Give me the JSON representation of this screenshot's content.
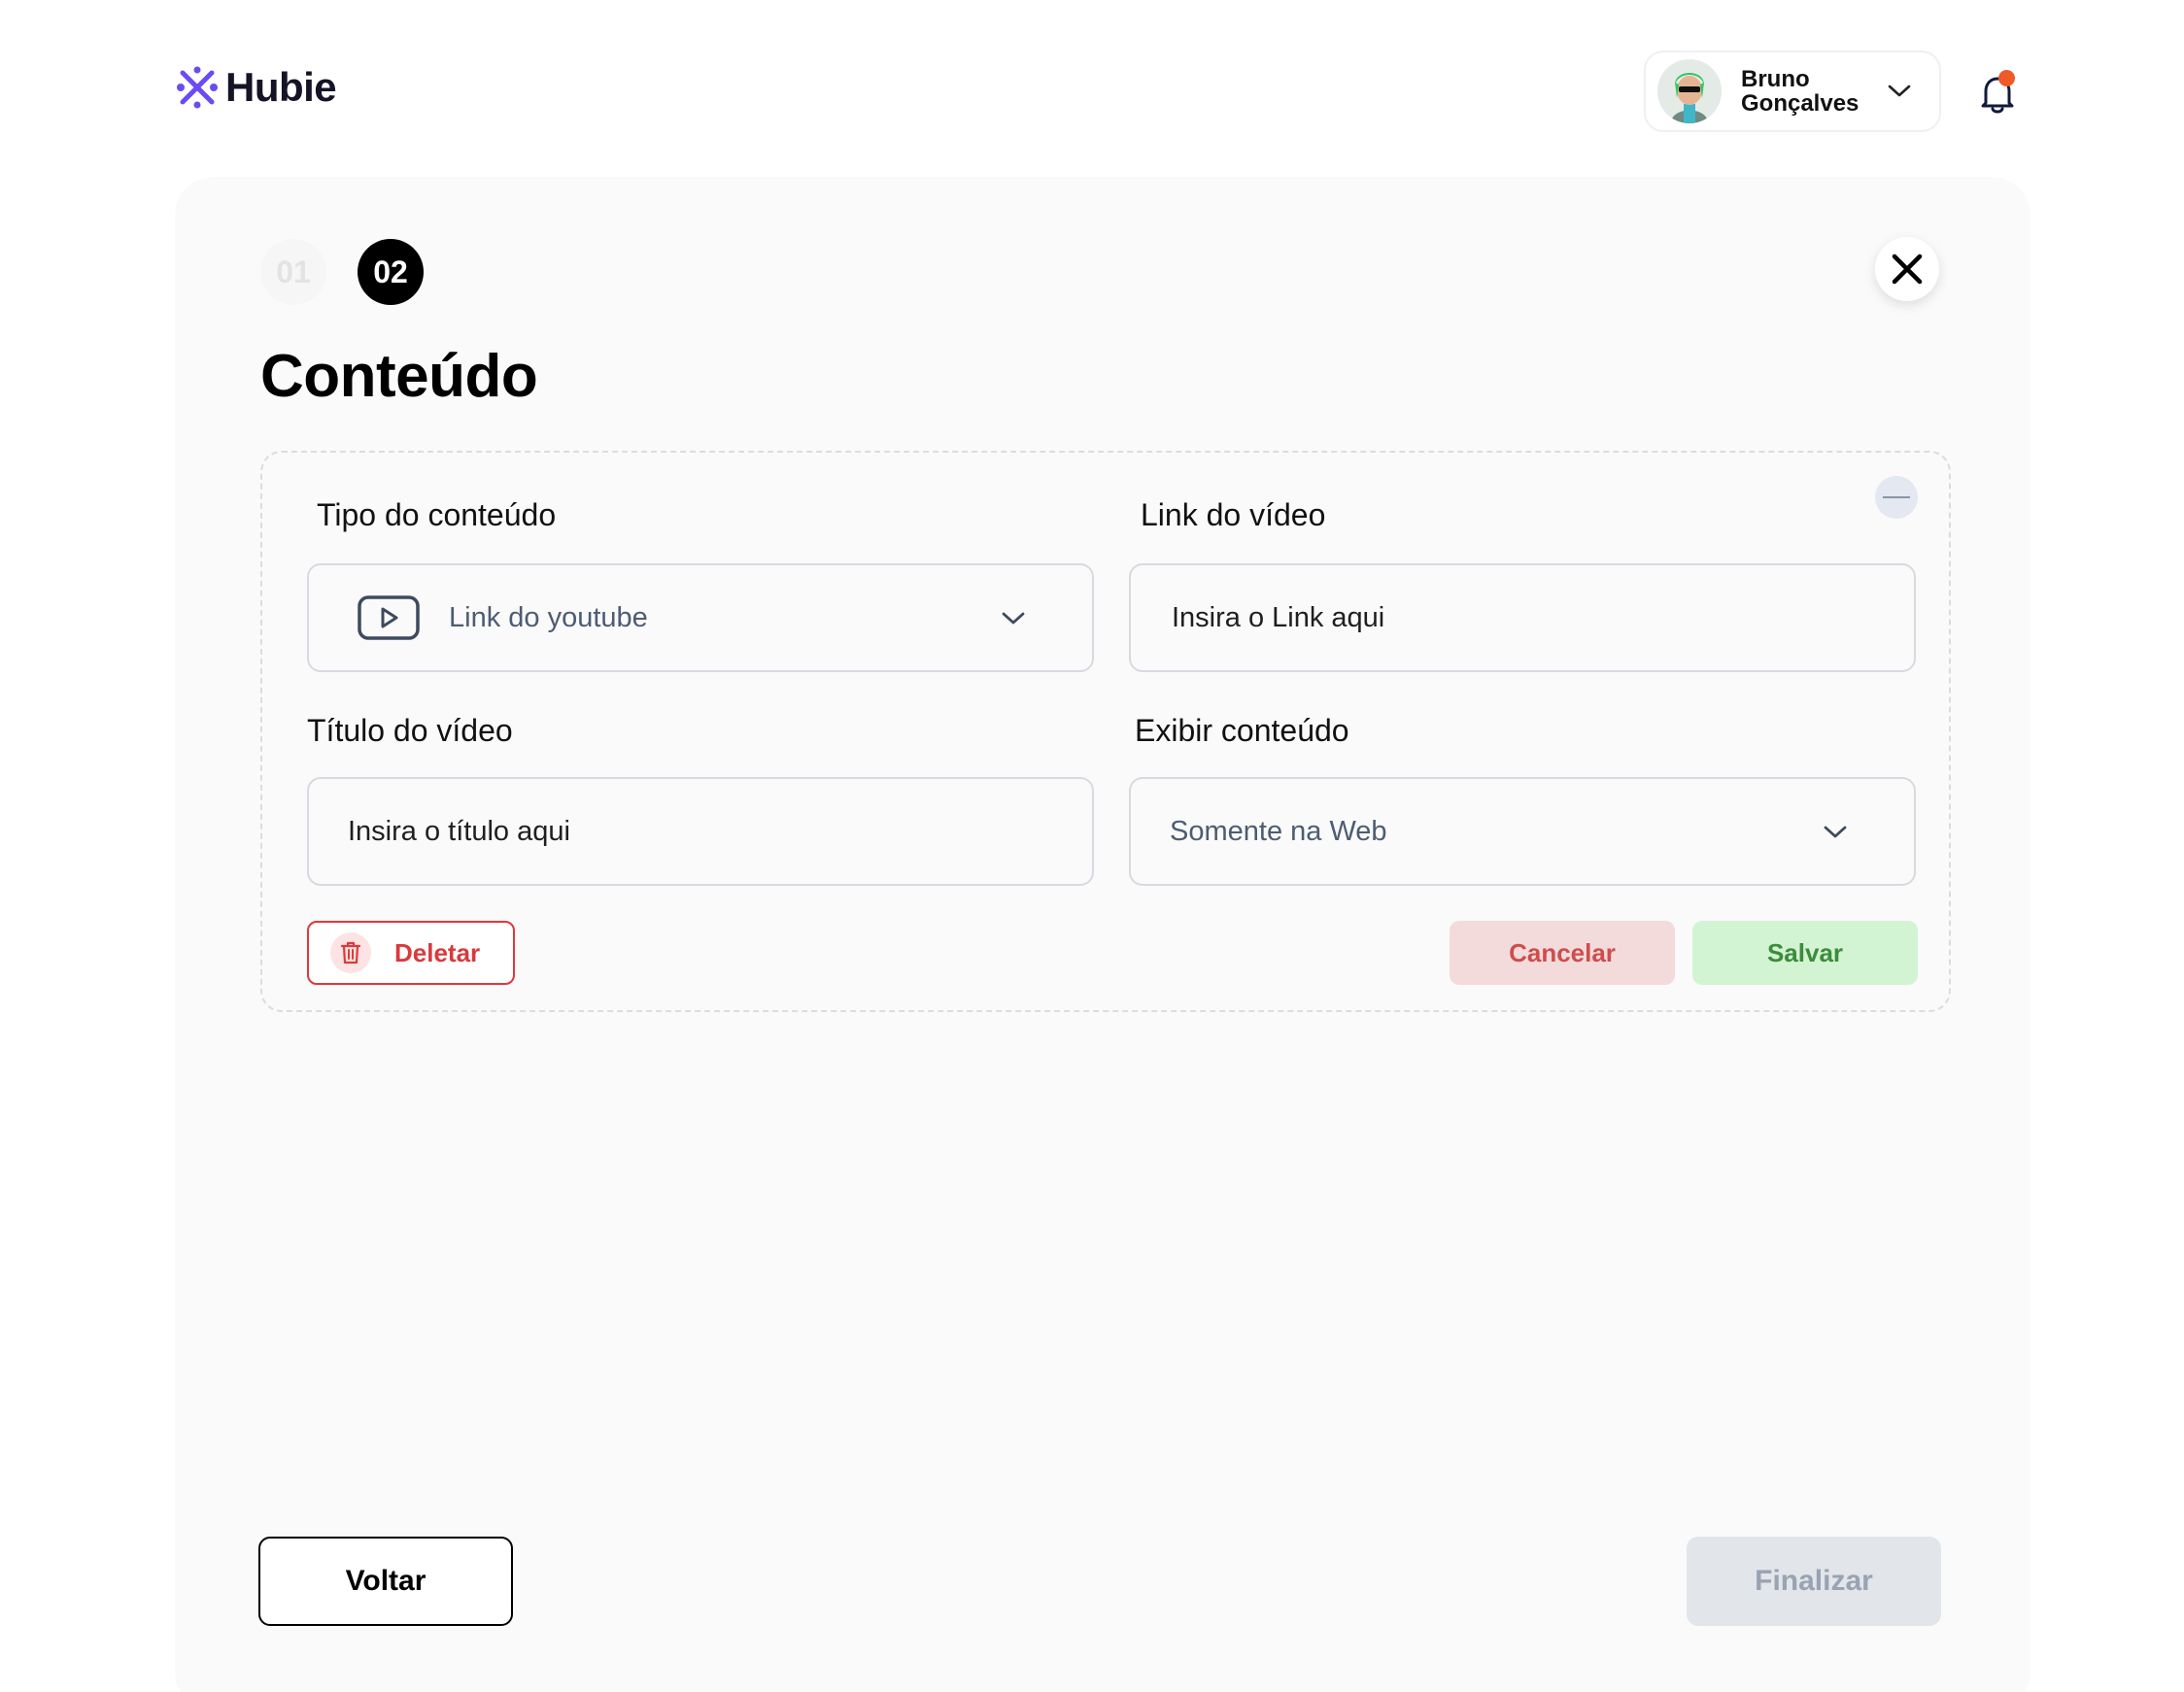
{
  "header": {
    "brand": "Hubie",
    "brand_color": "#6b4bf5",
    "user": {
      "name": "Bruno Gonçalves"
    },
    "notification_dot_color": "#f05a28"
  },
  "steps": [
    {
      "label": "01",
      "active": false
    },
    {
      "label": "02",
      "active": true
    }
  ],
  "page_title": "Conteúdo",
  "form": {
    "content_type": {
      "label": "Tipo do conteúdo",
      "value": "Link do youtube",
      "icon": "play-icon"
    },
    "video_link": {
      "label": "Link do vídeo",
      "placeholder": "Insira o Link aqui"
    },
    "video_title": {
      "label": "Título do vídeo",
      "placeholder": "Insira o título aqui"
    },
    "display": {
      "label": "Exibir conteúdo",
      "value": "Somente na Web"
    },
    "delete_label": "Deletar",
    "cancel_label": "Cancelar",
    "save_label": "Salvar"
  },
  "footer": {
    "back_label": "Voltar",
    "finish_label": "Finalizar"
  }
}
